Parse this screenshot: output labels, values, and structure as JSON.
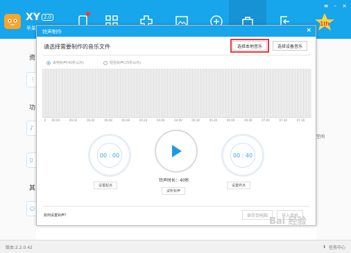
{
  "app": {
    "brand": "XY",
    "version_badge": "2.0",
    "brand_sub": "苹果"
  },
  "window_controls": [
    "≡",
    "–",
    "×"
  ],
  "background": {
    "sections": [
      "资",
      "功",
      "其"
    ],
    "right_text": "空间"
  },
  "dialog": {
    "title": "铃声制作",
    "close": "×",
    "subtitle": "请选择需要制作的音乐文件",
    "btn_local": "选择本地音乐",
    "btn_device": "选择设备音乐",
    "radio_long": "来电铃声(40秒以内)",
    "radio_short": "短信铃声(25秒以内)",
    "timeline": [
      "0",
      "00.00",
      "00.02",
      "00.02",
      "00.08",
      "00.08",
      "00.24",
      "04.00",
      "04.00",
      "00.30",
      "00.30",
      "00.00",
      "00.06",
      "07.00",
      "07.30",
      "07.30"
    ],
    "start_time": "00 : 00",
    "end_time": "00 : 40",
    "btn_set_start": "设置起点",
    "btn_set_end": "设置终点",
    "duration": "铃声时长：40秒",
    "btn_preview": "试听铃声",
    "help_link": "如何设置铃声？",
    "btn_save_pc": "保存到电脑",
    "btn_import": "导入手机"
  },
  "status": {
    "version": "版本:2.2.0.42",
    "task_center": "任务中心"
  },
  "watermark": "Bai 经验",
  "colors": {
    "brand": "#17a5eb",
    "highlight": "#e53935",
    "accent": "#3aa5dd"
  }
}
